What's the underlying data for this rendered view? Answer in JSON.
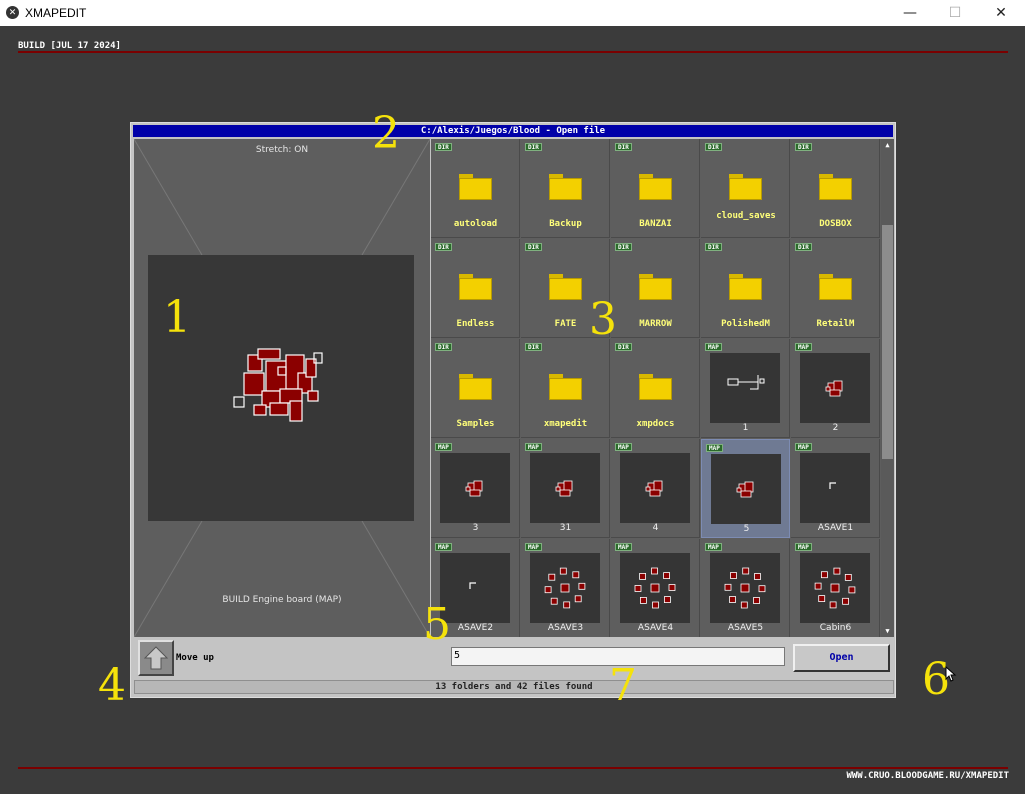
{
  "window": {
    "title": "XMAPEDIT",
    "minimize": "—",
    "maximize": "☐",
    "close": "✕"
  },
  "build": "BUILD [JUL 17 2024]",
  "footer_url": "WWW.CRUO.BLOODGAME.RU/XMAPEDIT",
  "dialog": {
    "title": "C:/Alexis/Juegos/Blood - Open file",
    "stretch": "Stretch: ON",
    "preview_caption": "BUILD Engine board (MAP)",
    "move_up": "Move up",
    "filename": "5",
    "open": "Open",
    "status": "13 folders and 42 files found"
  },
  "items": [
    {
      "type": "DIR",
      "name": "autoload"
    },
    {
      "type": "DIR",
      "name": "Backup"
    },
    {
      "type": "DIR",
      "name": "BANZAI"
    },
    {
      "type": "DIR",
      "name": "cloud_saves"
    },
    {
      "type": "DIR",
      "name": "DOSBOX"
    },
    {
      "type": "DIR",
      "name": "Endless"
    },
    {
      "type": "DIR",
      "name": "FATE"
    },
    {
      "type": "DIR",
      "name": "MARROW"
    },
    {
      "type": "DIR",
      "name": "PolishedM"
    },
    {
      "type": "DIR",
      "name": "RetailM"
    },
    {
      "type": "DIR",
      "name": "Samples"
    },
    {
      "type": "DIR",
      "name": "xmapedit"
    },
    {
      "type": "DIR",
      "name": "xmpdocs"
    },
    {
      "type": "MAP",
      "name": "1"
    },
    {
      "type": "MAP",
      "name": "2"
    },
    {
      "type": "MAP",
      "name": "3"
    },
    {
      "type": "MAP",
      "name": "31"
    },
    {
      "type": "MAP",
      "name": "4"
    },
    {
      "type": "MAP",
      "name": "5",
      "selected": true
    },
    {
      "type": "MAP",
      "name": "ASAVE1"
    },
    {
      "type": "MAP",
      "name": "ASAVE2"
    },
    {
      "type": "MAP",
      "name": "ASAVE3"
    },
    {
      "type": "MAP",
      "name": "ASAVE4"
    },
    {
      "type": "MAP",
      "name": "ASAVE5"
    },
    {
      "type": "MAP",
      "name": "Cabin6"
    }
  ],
  "annotations": [
    "1",
    "2",
    "3",
    "4",
    "5",
    "6",
    "7"
  ],
  "colors": {
    "dialog_title": "#0000a8",
    "folder": "#f3d000",
    "map_red": "#8b0000",
    "accent_line": "#7a0000"
  }
}
